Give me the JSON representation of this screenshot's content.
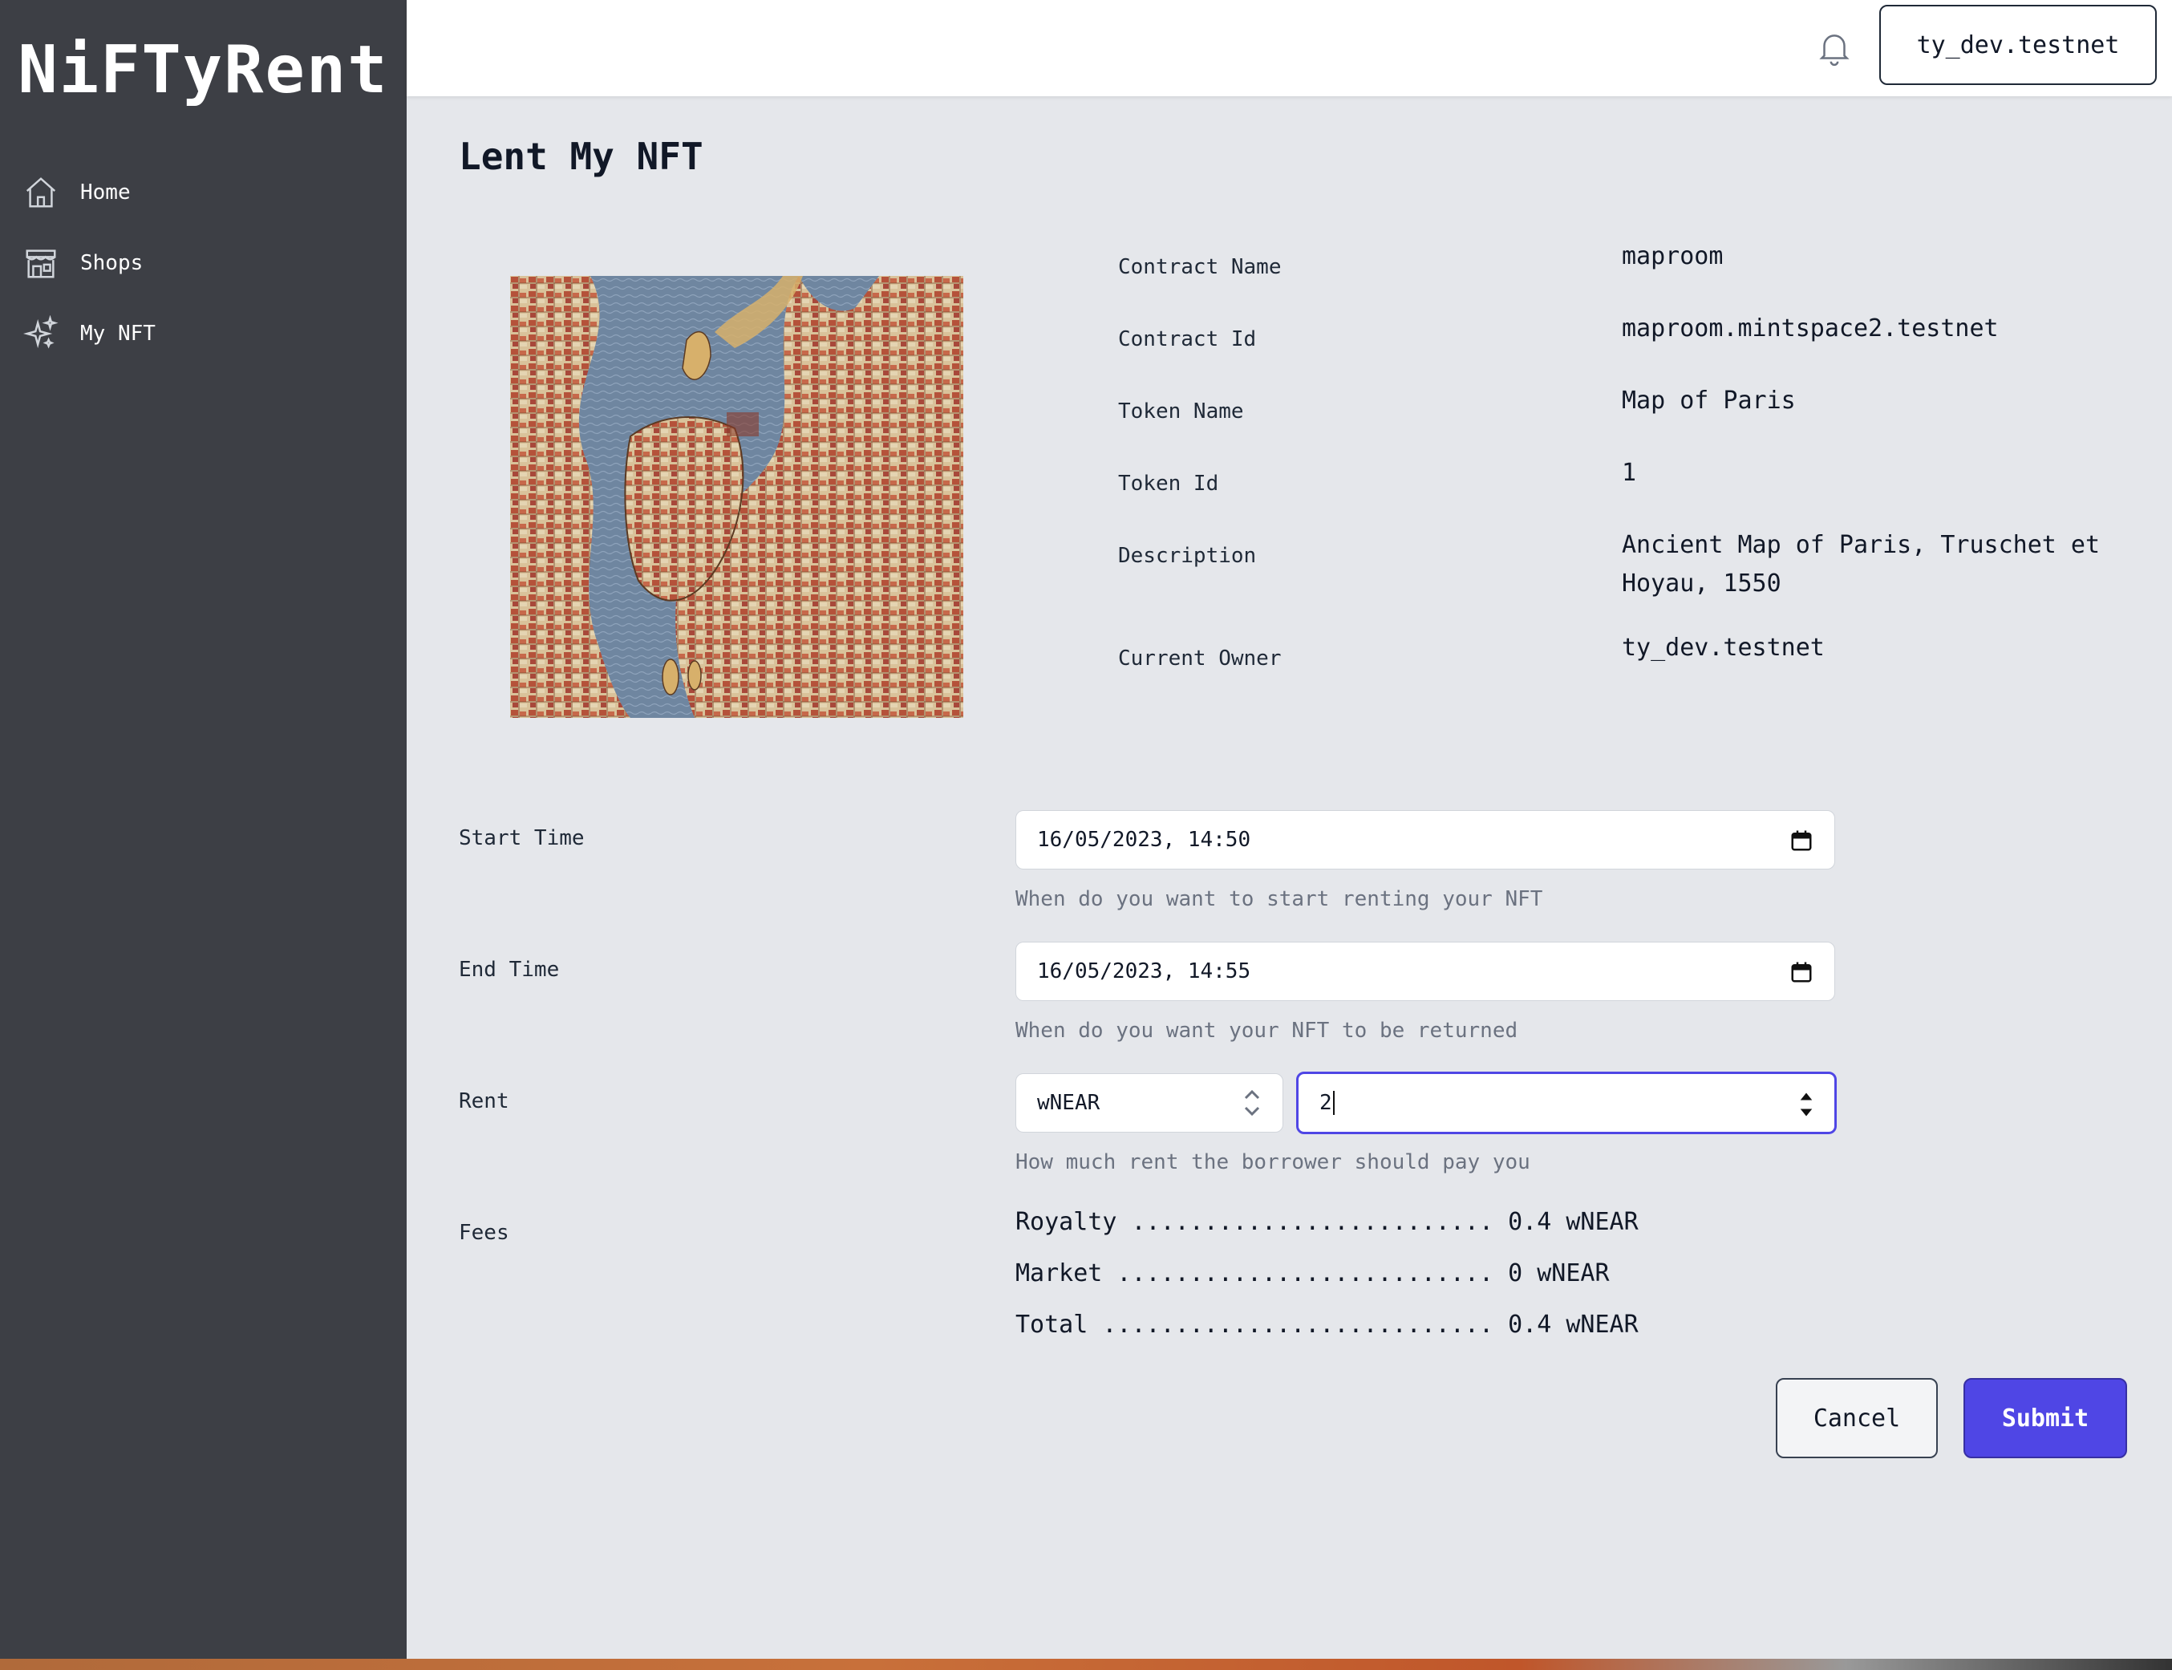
{
  "app": {
    "title": "NiFTyRent"
  },
  "sidebar": {
    "items": [
      {
        "label": "Home",
        "icon": "home-icon"
      },
      {
        "label": "Shops",
        "icon": "shop-icon"
      },
      {
        "label": "My NFT",
        "icon": "sparkles-icon"
      }
    ]
  },
  "header": {
    "account": "ty_dev.testnet",
    "notification_icon": "bell-icon"
  },
  "page": {
    "title": "Lent My NFT"
  },
  "nft": {
    "image": "nft-map-image",
    "info": [
      {
        "label": "Contract Name",
        "value": "maproom"
      },
      {
        "label": "Contract Id",
        "value": "maproom.mintspace2.testnet"
      },
      {
        "label": "Token Name",
        "value": "Map of Paris"
      },
      {
        "label": "Token Id",
        "value": "1"
      },
      {
        "label": "Description",
        "value": "Ancient Map of Paris, Truschet et Hoyau, 1550"
      },
      {
        "label": "Current Owner",
        "value": "ty_dev.testnet"
      }
    ]
  },
  "form": {
    "start_time": {
      "label": "Start Time",
      "value": "16/05/2023, 14:50",
      "help": "When do you want to start renting your NFT"
    },
    "end_time": {
      "label": "End Time",
      "value": "16/05/2023, 14:55",
      "help": "When do you want your NFT to be returned"
    },
    "rent": {
      "label": "Rent",
      "currency": "wNEAR",
      "amount": "2",
      "help": "How much rent the borrower should pay you"
    },
    "fees": {
      "label": "Fees",
      "lines": [
        "Royalty ......................... 0.4 wNEAR",
        "Market .......................... 0 wNEAR",
        "Total ........................... 0.4 wNEAR"
      ]
    }
  },
  "actions": {
    "cancel": "Cancel",
    "submit": "Submit"
  },
  "colors": {
    "sidebar": "#3d3f45",
    "accent": "#4f46e5",
    "background": "#e5e7eb"
  }
}
